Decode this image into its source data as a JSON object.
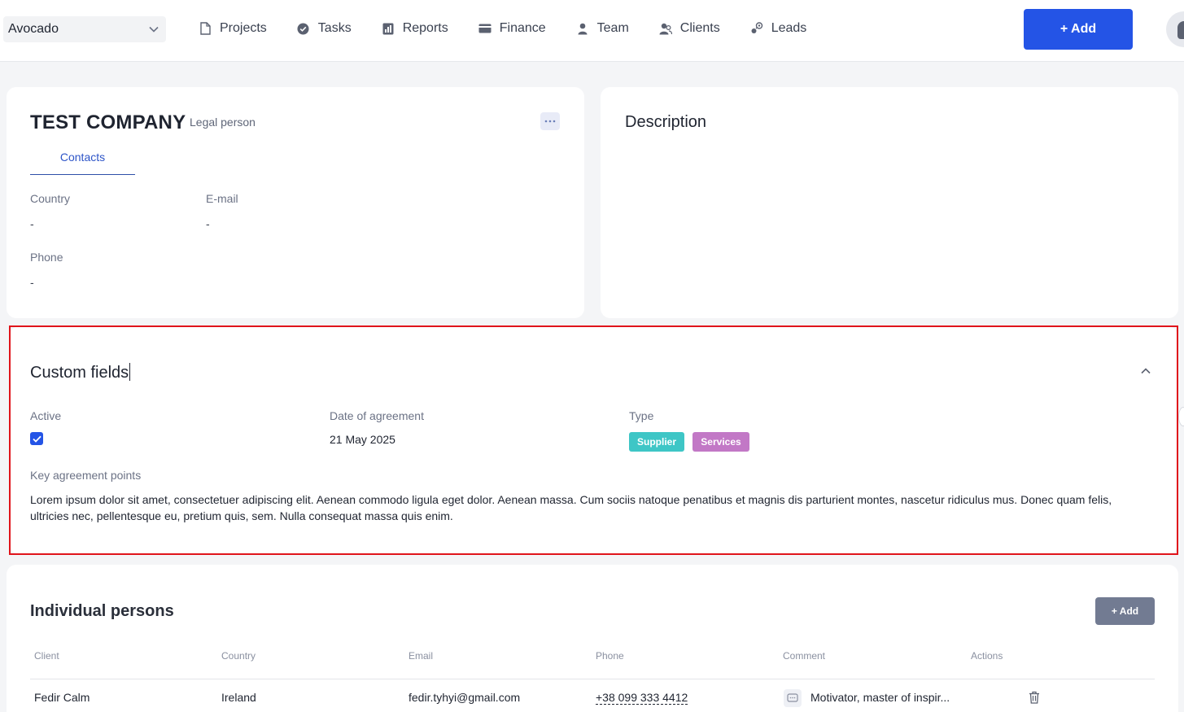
{
  "topbar": {
    "company": "Avocado",
    "nav": [
      {
        "label": "Projects",
        "icon": "document-icon"
      },
      {
        "label": "Tasks",
        "icon": "check-circle-icon"
      },
      {
        "label": "Reports",
        "icon": "report-icon"
      },
      {
        "label": "Finance",
        "icon": "card-icon"
      },
      {
        "label": "Team",
        "icon": "user-icon"
      },
      {
        "label": "Clients",
        "icon": "users-icon"
      },
      {
        "label": "Leads",
        "icon": "leads-icon"
      }
    ],
    "add_label": "+ Add"
  },
  "company": {
    "name": "TEST COMPANY",
    "kind": "Legal person",
    "tab": "Contacts",
    "fields": {
      "country_label": "Country",
      "country_value": "-",
      "email_label": "E-mail",
      "email_value": "-",
      "phone_label": "Phone",
      "phone_value": "-"
    }
  },
  "description": {
    "title": "Description"
  },
  "custom_fields": {
    "title": "Custom fields",
    "active_label": "Active",
    "active_checked": true,
    "date_label": "Date of agreement",
    "date_value": "21 May 2025",
    "type_label": "Type",
    "tags": [
      {
        "label": "Supplier",
        "color": "#3ec6c6"
      },
      {
        "label": "Services",
        "color": "#c278c6"
      }
    ],
    "key_points_label": "Key agreement points",
    "key_points_text": "Lorem ipsum dolor sit amet, consectetuer adipiscing elit. Aenean commodo ligula eget dolor. Aenean massa. Cum sociis natoque penatibus et magnis dis parturient montes, nascetur ridiculus mus. Donec quam felis, ultricies nec, pellentesque eu, pretium quis, sem. Nulla consequat massa quis enim."
  },
  "persons": {
    "title": "Individual persons",
    "add_label": "+ Add",
    "columns": [
      "Client",
      "Country",
      "Email",
      "Phone",
      "Comment",
      "Actions"
    ],
    "rows": [
      {
        "client": "Fedir Calm",
        "country": "Ireland",
        "email": "fedir.tyhyi@gmail.com",
        "phone": "+38 099 333 4412",
        "comment": "Motivator, master of inspir..."
      }
    ]
  },
  "colors": {
    "accent": "#2454e6",
    "highlight_border": "#e0141b"
  }
}
